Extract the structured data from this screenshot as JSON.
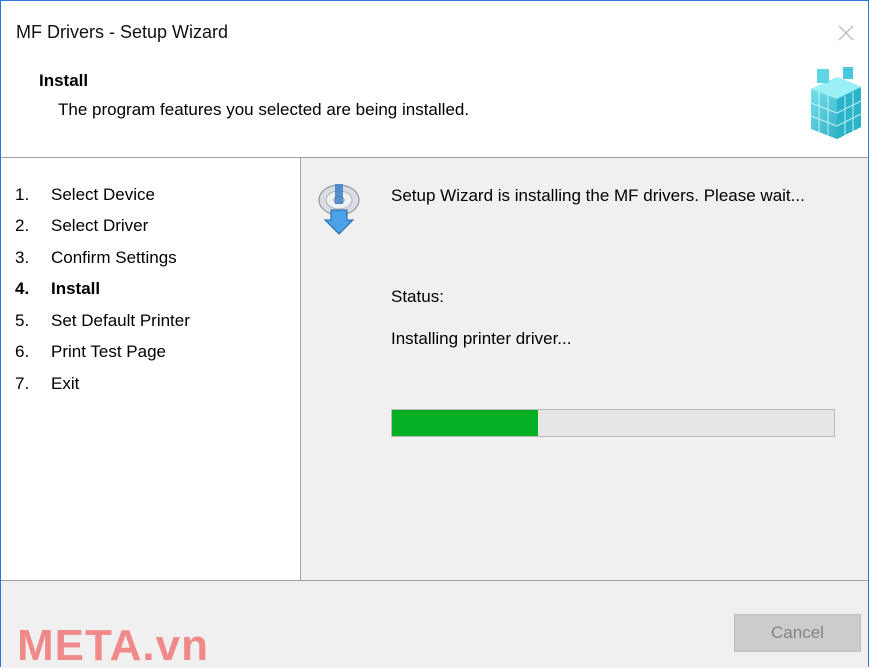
{
  "window": {
    "title": "MF Drivers - Setup Wizard",
    "close_icon": "close-icon"
  },
  "header": {
    "title": "Install",
    "description": "The program features you selected are being installed.",
    "logo_icon": "cube-grid-logo-icon"
  },
  "steps": [
    {
      "num": "1.",
      "label": "Select Device",
      "current": false
    },
    {
      "num": "2.",
      "label": "Select Driver",
      "current": false
    },
    {
      "num": "3.",
      "label": "Confirm Settings",
      "current": false
    },
    {
      "num": "4.",
      "label": "Install",
      "current": true
    },
    {
      "num": "5.",
      "label": "Set Default Printer",
      "current": false
    },
    {
      "num": "6.",
      "label": "Print Test Page",
      "current": false
    },
    {
      "num": "7.",
      "label": "Exit",
      "current": false
    }
  ],
  "content": {
    "install_icon": "disc-install-icon",
    "message": "Setup Wizard is installing the MF drivers. Please wait...",
    "status_label": "Status:",
    "status_text": "Installing printer driver...",
    "progress_fraction": 0.33,
    "progress_color": "#06b025"
  },
  "footer": {
    "cancel_label": "Cancel",
    "watermark": "META.vn"
  }
}
